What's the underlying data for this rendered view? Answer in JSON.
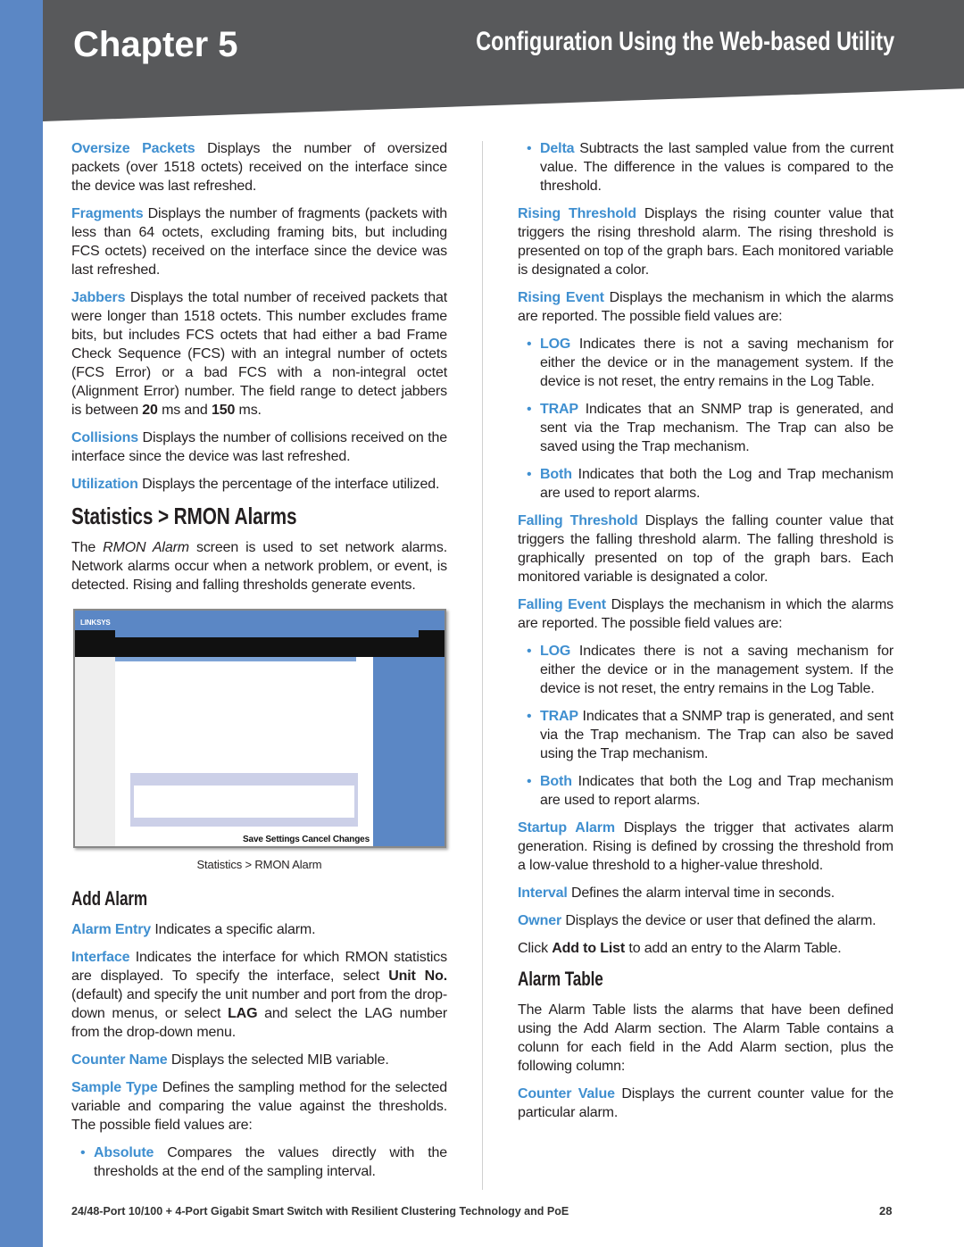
{
  "header": {
    "chapter": "Chapter 5",
    "title": "Configuration Using the Web-based Utility"
  },
  "left": [
    {
      "k": "p",
      "runs": [
        {
          "s": "t",
          "v": "Oversize Packets"
        },
        {
          "v": "  Displays the number of oversized packets (over 1518 octets) received on the interface since the device was last refreshed."
        }
      ]
    },
    {
      "k": "p",
      "runs": [
        {
          "s": "t",
          "v": "Fragments"
        },
        {
          "v": "  Displays the number of fragments (packets with less than 64 octets, excluding framing bits, but including FCS octets) received on the interface since the device was last refreshed."
        }
      ]
    },
    {
      "k": "p",
      "runs": [
        {
          "s": "t",
          "v": "Jabbers"
        },
        {
          "v": "  Displays the total number of received packets that were longer than 1518 octets. This number excludes frame bits, but includes FCS octets that had either a bad Frame Check Sequence (FCS) with an integral number of octets (FCS Error) or a bad FCS with a non-integral octet (Alignment Error) number. The field range to detect jabbers is between "
        },
        {
          "s": "b",
          "v": "20"
        },
        {
          "v": " ms and "
        },
        {
          "s": "b",
          "v": "150"
        },
        {
          "v": " ms."
        }
      ]
    },
    {
      "k": "p",
      "runs": [
        {
          "s": "t",
          "v": "Collisions"
        },
        {
          "v": "  Displays the number of collisions received on the interface since the device was last refreshed."
        }
      ]
    },
    {
      "k": "p",
      "runs": [
        {
          "s": "t",
          "v": "Utilization"
        },
        {
          "v": "  Displays the percentage of the interface utilized."
        }
      ]
    },
    {
      "k": "h2",
      "runs": [
        {
          "v": "Statistics > RMON Alarms"
        }
      ]
    },
    {
      "k": "p",
      "runs": [
        {
          "v": "The "
        },
        {
          "s": "i",
          "v": "RMON Alarm"
        },
        {
          "v": " screen is used to set network alarms. Network alarms occur when a network problem, or event, is detected. Rising and falling thresholds generate events."
        }
      ]
    },
    {
      "k": "fig"
    },
    {
      "k": "caption",
      "runs": [
        {
          "v": "Statistics > RMON Alarm"
        }
      ]
    },
    {
      "k": "h3",
      "runs": [
        {
          "v": "Add Alarm"
        }
      ]
    },
    {
      "k": "p",
      "runs": [
        {
          "s": "t",
          "v": "Alarm Entry"
        },
        {
          "v": "  Indicates a specific alarm."
        }
      ]
    },
    {
      "k": "p",
      "runs": [
        {
          "s": "t",
          "v": "Interface"
        },
        {
          "v": "  Indicates the interface for which RMON statistics are displayed. To specify the interface, select "
        },
        {
          "s": "b",
          "v": "Unit No."
        },
        {
          "v": " (default) and specify the unit number and port from the drop-down menus, or select "
        },
        {
          "s": "b",
          "v": "LAG"
        },
        {
          "v": " and select the LAG number from the drop-down menu."
        }
      ]
    },
    {
      "k": "p",
      "runs": [
        {
          "s": "t",
          "v": "Counter Name"
        },
        {
          "v": "  Displays the selected MIB variable."
        }
      ]
    },
    {
      "k": "p",
      "runs": [
        {
          "s": "t",
          "v": "Sample Type"
        },
        {
          "v": "  Defines the sampling method for the selected variable and comparing the value against the thresholds. The possible field values are:"
        }
      ]
    },
    {
      "k": "b",
      "runs": [
        {
          "s": "t",
          "v": "Absolute"
        },
        {
          "v": "  Compares the values directly with the thresholds at the end of the sampling interval."
        }
      ]
    }
  ],
  "right": [
    {
      "k": "b",
      "runs": [
        {
          "s": "t",
          "v": "Delta"
        },
        {
          "v": "  Subtracts the last sampled value from the current value. The difference in the values is compared to the threshold."
        }
      ]
    },
    {
      "k": "p",
      "runs": [
        {
          "s": "t",
          "v": "Rising Threshold"
        },
        {
          "v": "  Displays the rising counter value that triggers the rising threshold alarm. The rising threshold is presented on top of the graph bars. Each monitored variable is designated a color."
        }
      ]
    },
    {
      "k": "p",
      "runs": [
        {
          "s": "t",
          "v": "Rising Event"
        },
        {
          "v": "  Displays the mechanism in which the alarms are reported. The possible field values are:"
        }
      ]
    },
    {
      "k": "b",
      "runs": [
        {
          "s": "t",
          "v": "LOG"
        },
        {
          "v": "  Indicates there is not a saving mechanism for either the device or in the management system. If the device is not reset, the entry remains in the Log Table."
        }
      ]
    },
    {
      "k": "b",
      "runs": [
        {
          "s": "t",
          "v": "TRAP"
        },
        {
          "v": "  Indicates that an SNMP trap is generated, and sent via the Trap mechanism. The Trap can also be saved using the Trap mechanism."
        }
      ]
    },
    {
      "k": "b",
      "runs": [
        {
          "s": "t",
          "v": "Both"
        },
        {
          "v": "  Indicates that both the Log and Trap mechanism are used to report alarms."
        }
      ]
    },
    {
      "k": "p",
      "runs": [
        {
          "s": "t",
          "v": "Falling Threshold"
        },
        {
          "v": "  Displays the falling counter value that triggers the falling threshold alarm. The falling threshold is graphically presented on top of the graph bars. Each monitored variable is designated a color."
        }
      ]
    },
    {
      "k": "p",
      "runs": [
        {
          "s": "t",
          "v": "Falling Event"
        },
        {
          "v": "  Displays the mechanism in which the alarms are reported. The possible field values are:"
        }
      ]
    },
    {
      "k": "b",
      "runs": [
        {
          "s": "t",
          "v": "LOG"
        },
        {
          "v": "  Indicates there is not a saving mechanism for either the device or in the management system. If the device is not reset, the entry remains in the Log Table."
        }
      ]
    },
    {
      "k": "b",
      "runs": [
        {
          "s": "t",
          "v": "TRAP"
        },
        {
          "v": "  Indicates that a SNMP trap is generated, and sent via the Trap mechanism. The Trap can also be saved using the Trap mechanism."
        }
      ]
    },
    {
      "k": "b",
      "runs": [
        {
          "s": "t",
          "v": "Both"
        },
        {
          "v": "  Indicates that both the Log and Trap mechanism are used to report alarms."
        }
      ]
    },
    {
      "k": "p",
      "runs": [
        {
          "s": "t",
          "v": "Startup Alarm"
        },
        {
          "v": "  Displays the trigger that activates alarm generation. Rising is defined by crossing the threshold from a low-value threshold to a higher-value threshold."
        }
      ]
    },
    {
      "k": "p",
      "runs": [
        {
          "s": "t",
          "v": "Interval"
        },
        {
          "v": "  Defines the alarm interval time in seconds."
        }
      ]
    },
    {
      "k": "p",
      "runs": [
        {
          "s": "t",
          "v": "Owner"
        },
        {
          "v": "  Displays the device or user that defined the alarm."
        }
      ]
    },
    {
      "k": "p",
      "runs": [
        {
          "v": "Click "
        },
        {
          "s": "b",
          "v": "Add to List"
        },
        {
          "v": " to add an entry to the Alarm Table."
        }
      ]
    },
    {
      "k": "h3",
      "runs": [
        {
          "v": "Alarm Table"
        }
      ]
    },
    {
      "k": "p",
      "runs": [
        {
          "v": "The Alarm Table lists the alarms that have been defined using the Add Alarm section. The Alarm Table contains a colunn for each field in the Add Alarm section, plus the following column:"
        }
      ]
    },
    {
      "k": "p",
      "runs": [
        {
          "s": "t",
          "v": "Counter Value"
        },
        {
          "v": "  Displays the current counter value for the particular alarm."
        }
      ]
    }
  ],
  "figure": {
    "logo": "LINKSYS",
    "save_label": "Save Settings",
    "cancel_label": "Cancel Changes"
  },
  "footer": {
    "text": "24/48-Port 10/100 + 4-Port Gigabit Smart Switch with Resilient Clustering Technology and PoE",
    "page": "28"
  }
}
